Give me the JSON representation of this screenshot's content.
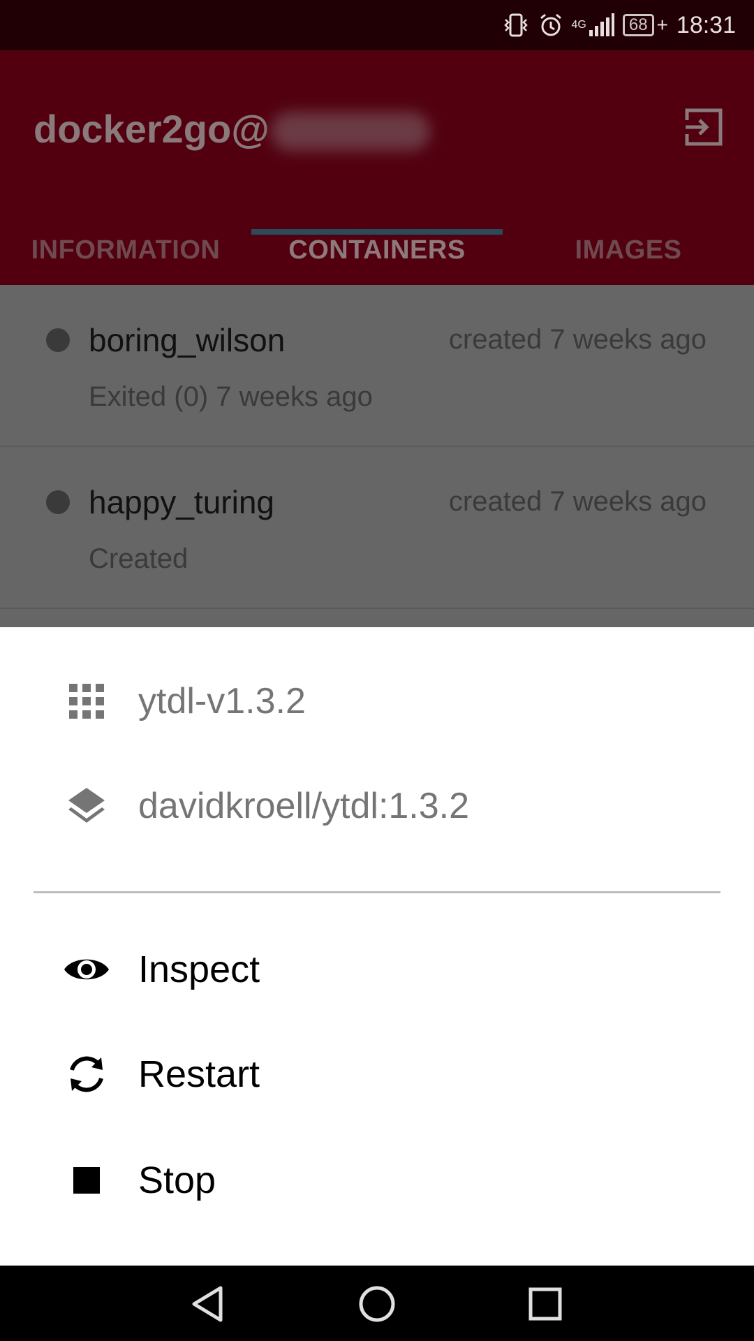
{
  "status_bar": {
    "network": "4G",
    "battery": "68",
    "time": "18:31"
  },
  "app_bar": {
    "title": "docker2go@",
    "tabs": [
      "INFORMATION",
      "CONTAINERS",
      "IMAGES"
    ],
    "active_tab": "CONTAINERS"
  },
  "containers": [
    {
      "name": "boring_wilson",
      "created": "created 7 weeks ago",
      "status": "Exited (0) 7 weeks ago"
    },
    {
      "name": "happy_turing",
      "created": "created 7 weeks ago",
      "status": "Created"
    }
  ],
  "bottom_sheet": {
    "container_name": "ytdl-v1.3.2",
    "image": "davidkroell/ytdl:1.3.2",
    "actions": [
      "Inspect",
      "Restart",
      "Stop"
    ]
  },
  "icons": {
    "status": [
      "vibrate-icon",
      "alarm-icon",
      "signal-icon",
      "battery-icon"
    ],
    "app_bar": "logout-icon",
    "container": "apps-grid-icon",
    "image": "layers-icon",
    "actions": [
      "eye-icon",
      "restart-icon",
      "stop-icon"
    ],
    "nav": [
      "back-icon",
      "home-icon",
      "recents-icon"
    ]
  },
  "colors": {
    "app_bar": "#520010",
    "status_bar": "#200004",
    "tab_indicator": "#2b4a5a",
    "scrim_list": "#666666"
  }
}
